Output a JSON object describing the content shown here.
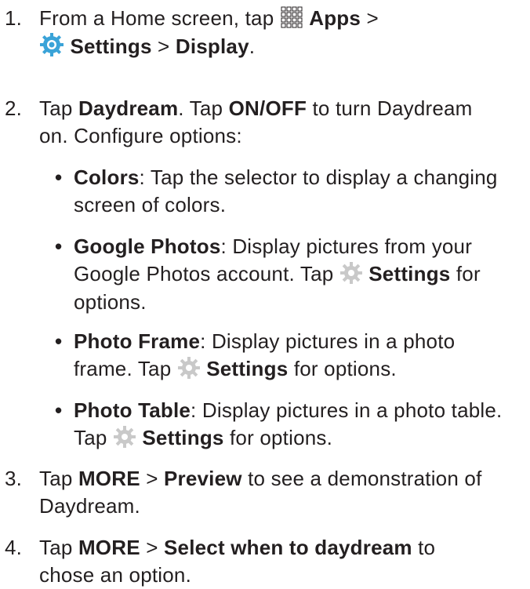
{
  "steps": [
    {
      "num": "1.",
      "line1_pre": "From a Home screen, tap ",
      "apps_icon": "apps-grid-icon",
      "apps_label": "Apps",
      "line1_post": " >",
      "settings_icon": "settings-gear-blue-icon",
      "settings_label": "Settings",
      "sep": " > ",
      "display_label": "Display",
      "end": "."
    },
    {
      "num": "2.",
      "pre": "Tap ",
      "daydream": "Daydream",
      "mid": ". Tap ",
      "onoff": "ON/OFF",
      "post1": " to turn Daydream",
      "line2": "on. Configure options:"
    },
    {
      "num": "3.",
      "pre": "Tap ",
      "more": "MORE",
      "sep": " > ",
      "preview": "Preview",
      "post1": " to see a demonstration of",
      "line2": "Daydream."
    },
    {
      "num": "4.",
      "pre": "Tap ",
      "more": "MORE",
      "sep": " > ",
      "select": "Select when to daydream",
      "post1": " to",
      "line2": "chose an option."
    }
  ],
  "bullets": [
    {
      "dot": "•",
      "term": "Colors",
      "line1": ": Tap the selector to display a changing",
      "line2": "screen of colors."
    },
    {
      "dot": "•",
      "term": "Google Photos",
      "line1": ": Display pictures from your",
      "line2_pre": "Google Photos account. Tap ",
      "gear_icon": "settings-gear-icon",
      "settings": "Settings",
      "line2_post": " for",
      "line3": "options."
    },
    {
      "dot": "•",
      "term": "Photo Frame",
      "line1": ": Display pictures in a photo",
      "line2_pre": "frame. Tap ",
      "gear_icon": "settings-gear-icon",
      "settings": "Settings",
      "line2_post": " for options."
    },
    {
      "dot": "•",
      "term": "Photo Table",
      "line1": ": Display pictures in a photo table.",
      "line2_pre": "Tap ",
      "gear_icon": "settings-gear-icon",
      "settings": "Settings",
      "line2_post": " for options."
    }
  ],
  "colors": {
    "text": "#231f20",
    "gear": "#c9c9c9",
    "settings_blue": "#3aa3d8"
  }
}
